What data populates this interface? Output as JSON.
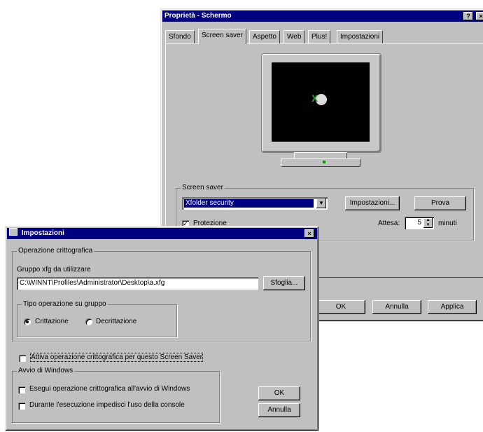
{
  "display": {
    "title": "Proprietà - Schermo",
    "help_button": "?",
    "close_button": "×",
    "tabs": [
      "Sfondo",
      "Screen saver",
      "Aspetto",
      "Web",
      "Plus!",
      "Impostazioni"
    ],
    "screensaver_group": "Screen saver",
    "screensaver_selected": "Xfolder security",
    "settings_button": "Impostazioni...",
    "preview_button": "Prova",
    "password_label": "Protezione",
    "password_checked": true,
    "wait_label": "Attesa:",
    "wait_value": "5",
    "wait_unit": "minuti",
    "ok_button": "OK",
    "cancel_button": "Annulla",
    "apply_button": "Applica"
  },
  "settings": {
    "title": "Impostazioni",
    "close_button": "×",
    "crypto_group": "Operazione crittografica",
    "group_label": "Gruppo xfg da utilizzare",
    "path_value": "C:\\WINNT\\Profiles\\Administrator\\Desktop\\a.xfg",
    "browse_button": "Sfoglia...",
    "optype_group": "Tipo operazione su gruppo",
    "encrypt_label": "Crittazione",
    "decrypt_label": "Decrittazione",
    "encrypt_selected": true,
    "activate_label": "Attiva operazione crittografica per questo Screen Saver",
    "startup_group": "Avvio di Windows",
    "startup_label": "Esegui operazione crittografica all'avvio di Windows",
    "console_label": "Durante l'esecuzione impedisci l'uso della console",
    "ok_button": "OK",
    "cancel_button": "Annulla"
  },
  "icons": [
    "display-properties-icon",
    "settings-window-icon",
    "dropdown-arrow-icon",
    "spinner-icon",
    "monitor-preview-icon",
    "screensaver-logo-icon"
  ]
}
